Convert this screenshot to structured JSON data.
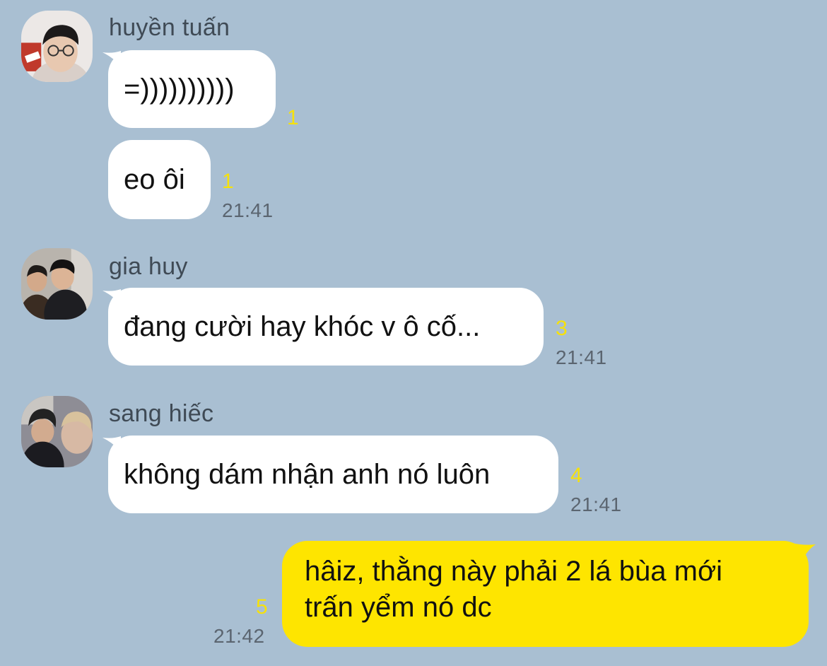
{
  "theme": {
    "background": "#a9bfd2",
    "incoming_bubble": "#ffffff",
    "outgoing_bubble": "#fee500",
    "unread_color": "#f6e10b",
    "time_color": "#5b6570"
  },
  "messages": [
    {
      "sender": "huyền tuấn",
      "avatar_icon": "profile-photo",
      "bubbles": [
        {
          "text": "=))))))))))",
          "unread": "1",
          "time": ""
        },
        {
          "text": "eo ôi",
          "unread": "1",
          "time": "21:41"
        }
      ]
    },
    {
      "sender": "gia huy",
      "avatar_icon": "profile-photo",
      "bubbles": [
        {
          "text": "đang cười hay khóc v ô cố...",
          "unread": "3",
          "time": "21:41"
        }
      ]
    },
    {
      "sender": "sang hiếc",
      "avatar_icon": "profile-photo",
      "bubbles": [
        {
          "text": "không dám nhận anh nó luôn",
          "unread": "4",
          "time": "21:41"
        }
      ]
    }
  ],
  "outgoing": {
    "line1": "hâiz, thằng này phải 2 lá bùa mới",
    "line2": "trấn yểm nó dc",
    "unread": "5",
    "time": "21:42"
  }
}
